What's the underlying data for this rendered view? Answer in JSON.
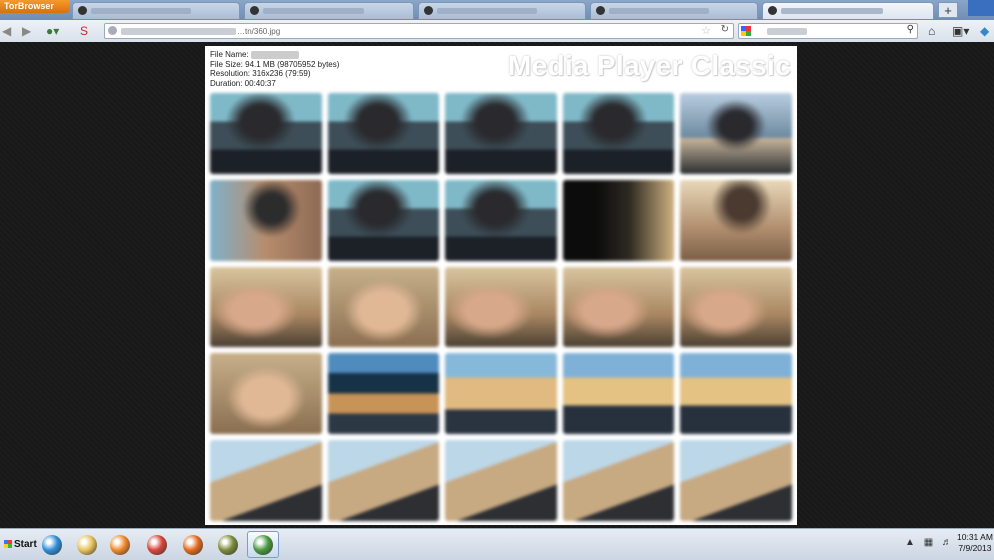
{
  "browser": {
    "menu_button": "TorBrowser",
    "new_tab": "+",
    "url": "…tn/360.jpg"
  },
  "viewer": {
    "info": {
      "file_name_label": "File Name:",
      "file_size": "File Size: 94.1 MB (98705952 bytes)",
      "resolution": "Resolution: 316x236 (79:59)",
      "duration": "Duration: 00:40:37"
    },
    "watermark": "Media Player Classic",
    "thumbnails": [
      "t-a",
      "t-a",
      "t-a",
      "t-a",
      "t-b",
      "t-c",
      "t-a",
      "t-a",
      "t-d",
      "t-e",
      "t-f",
      "t-g",
      "t-f",
      "t-f",
      "t-f",
      "t-g",
      "t-i",
      "t-h",
      "t-j",
      "t-j",
      "t-k",
      "t-k",
      "t-k",
      "t-k",
      "t-k"
    ]
  },
  "taskbar": {
    "start_label": "Start",
    "apps": [
      {
        "name": "internet-explorer-icon",
        "color": "#2f8fd8"
      },
      {
        "name": "file-explorer-icon",
        "color": "#e7c35a"
      },
      {
        "name": "media-player-icon",
        "color": "#f08a2a"
      },
      {
        "name": "chrome-icon",
        "color": "#d9453b"
      },
      {
        "name": "firefox-icon",
        "color": "#e36b1e"
      },
      {
        "name": "winamp-icon",
        "color": "#7d8b3a"
      },
      {
        "name": "tor-browser-icon",
        "color": "#4a9a3f"
      }
    ],
    "time": "10:31 AM",
    "date": "7/9/2013"
  }
}
